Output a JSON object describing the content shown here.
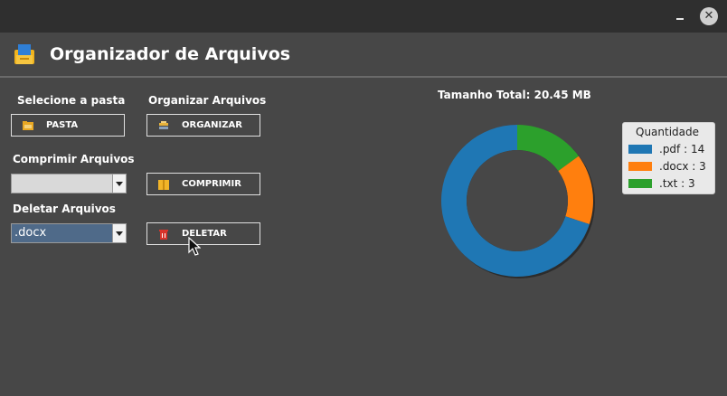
{
  "window": {
    "close_glyph": "✕"
  },
  "app": {
    "title": "Organizador de Arquivos",
    "icon": "folder-files-icon"
  },
  "sections": {
    "select_folder": {
      "label": "Selecione a pasta",
      "button_label": "PASTA",
      "icon": "folder-icon"
    },
    "organize": {
      "label": "Organizar Arquivos",
      "button_label": "ORGANIZAR",
      "icon": "organize-icon"
    },
    "compress": {
      "label": "Comprimir Arquivos",
      "combo_value": "",
      "button_label": "COMPRIMIR",
      "icon": "archive-icon"
    },
    "delete": {
      "label": "Deletar Arquivos",
      "combo_value": ".docx",
      "button_label": "DELETAR",
      "icon": "trash-icon"
    }
  },
  "chart_data": {
    "type": "pie",
    "title": "Tamanho Total: 20.45 MB",
    "legend_title": "Quantidade",
    "legend_position": "top-right",
    "slices": [
      {
        "label": ".pdf : 14",
        "value": 14,
        "color": "#1f77b4"
      },
      {
        "label": ".docx : 3",
        "value": 3,
        "color": "#ff7f0e"
      },
      {
        "label": ".txt : 3",
        "value": 3,
        "color": "#2ca02c"
      }
    ]
  },
  "colors": {
    "background": "#474747",
    "titlebar": "#2f2f2f",
    "combo_selected": "#4f6a89"
  }
}
